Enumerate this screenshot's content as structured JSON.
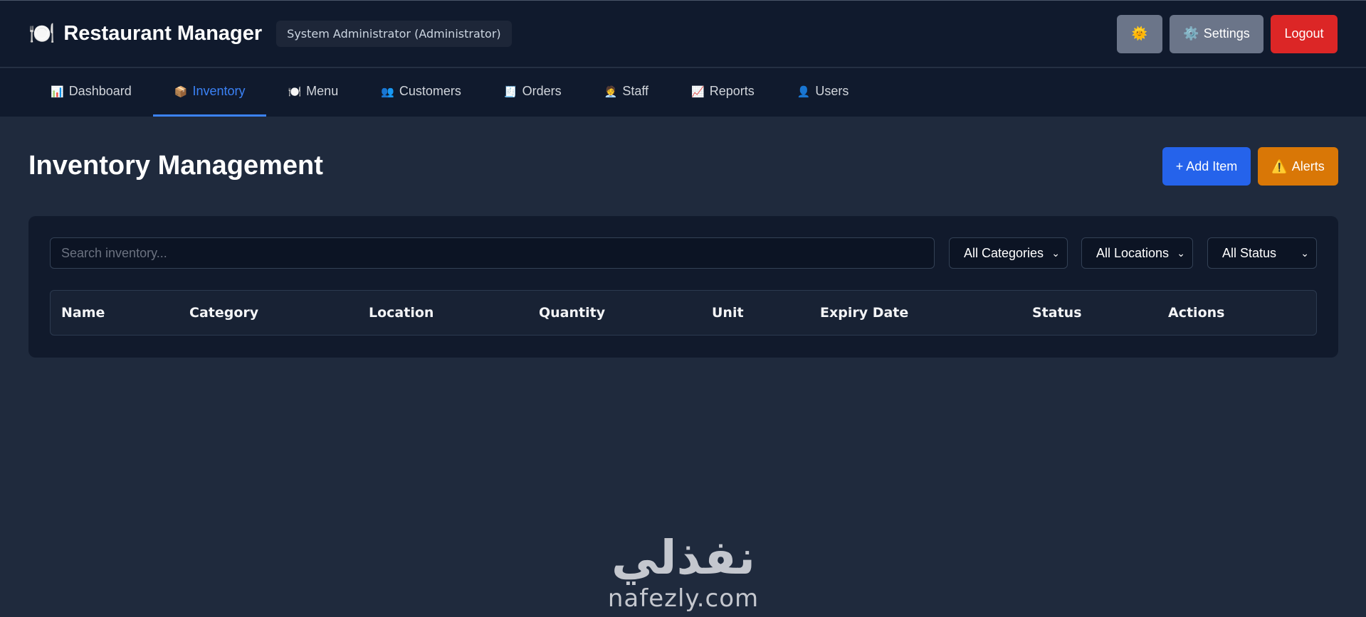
{
  "header": {
    "brand_icon": "🍽️",
    "title": "Restaurant Manager",
    "user_badge": "System Administrator (Administrator)",
    "theme_icon": "🌞",
    "settings_icon": "⚙️",
    "settings_label": "Settings",
    "logout_label": "Logout"
  },
  "nav": {
    "items": [
      {
        "icon": "📊",
        "label": "Dashboard"
      },
      {
        "icon": "📦",
        "label": "Inventory"
      },
      {
        "icon": "🍽️",
        "label": "Menu"
      },
      {
        "icon": "👥",
        "label": "Customers"
      },
      {
        "icon": "🧾",
        "label": "Orders"
      },
      {
        "icon": "🧑‍💼",
        "label": "Staff"
      },
      {
        "icon": "📈",
        "label": "Reports"
      },
      {
        "icon": "👤",
        "label": "Users"
      }
    ],
    "active": "Inventory"
  },
  "page": {
    "title": "Inventory Management",
    "add_label": "+ Add Item",
    "alerts_icon": "⚠️",
    "alerts_label": "Alerts"
  },
  "filters": {
    "search_placeholder": "Search inventory...",
    "category": "All Categories",
    "location": "All Locations",
    "status": "All Status"
  },
  "table": {
    "columns": [
      "Name",
      "Category",
      "Location",
      "Quantity",
      "Unit",
      "Expiry Date",
      "Status",
      "Actions"
    ],
    "rows": []
  },
  "watermark": {
    "arabic": "نفذلي",
    "latin": "nafezly.com"
  },
  "colors": {
    "primary": "#2563eb",
    "warning": "#d97706",
    "danger": "#dc2626",
    "background": "#1f2a3d",
    "header_bg": "#101a2d"
  }
}
